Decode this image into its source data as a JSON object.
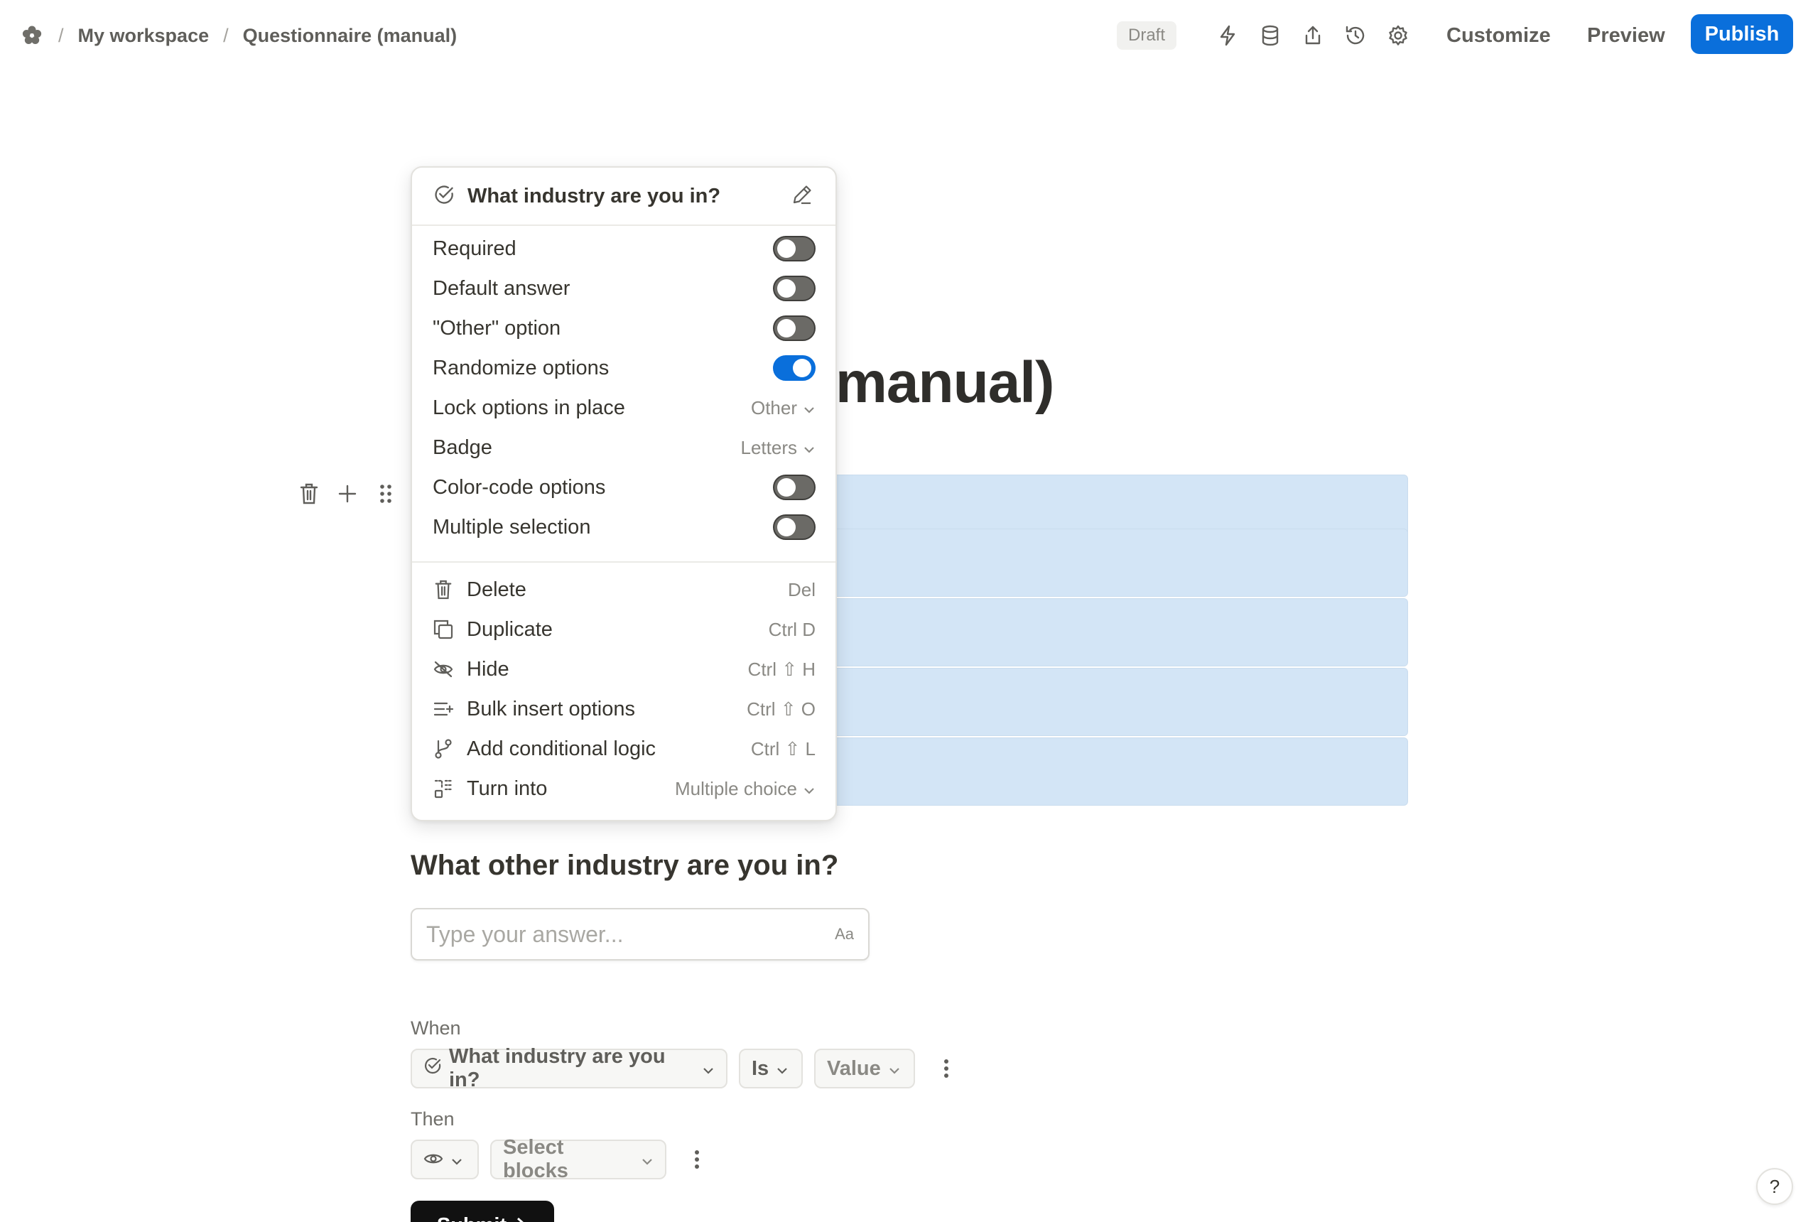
{
  "breadcrumb": {
    "workspace": "My workspace",
    "page": "Questionnaire (manual)",
    "separator": "/"
  },
  "header": {
    "status_badge": "Draft",
    "customize_label": "Customize",
    "preview_label": "Preview",
    "publish_label": "Publish",
    "accent_color": "#0a6fdb"
  },
  "page": {
    "title_fragment": "manual)"
  },
  "menu": {
    "question_title": "What industry are you in?",
    "settings": [
      {
        "label": "Required",
        "type": "toggle",
        "on": false
      },
      {
        "label": "Default answer",
        "type": "toggle",
        "on": false
      },
      {
        "label": "\"Other\" option",
        "type": "toggle",
        "on": false
      },
      {
        "label": "Randomize options",
        "type": "toggle",
        "on": true
      },
      {
        "label": "Lock options in place",
        "type": "select",
        "value": "Other"
      },
      {
        "label": "Badge",
        "type": "select",
        "value": "Letters"
      },
      {
        "label": "Color-code options",
        "type": "toggle",
        "on": false
      },
      {
        "label": "Multiple selection",
        "type": "toggle",
        "on": false
      }
    ],
    "actions": [
      {
        "label": "Delete",
        "icon": "trash-icon",
        "shortcut": "Del"
      },
      {
        "label": "Duplicate",
        "icon": "duplicate-icon",
        "shortcut": "Ctrl D"
      },
      {
        "label": "Hide",
        "icon": "eye-off-icon",
        "shortcut": "Ctrl ⇧ H"
      },
      {
        "label": "Bulk insert options",
        "icon": "bulk-insert-icon",
        "shortcut": "Ctrl ⇧ O"
      },
      {
        "label": "Add conditional logic",
        "icon": "branch-icon",
        "shortcut": "Ctrl ⇧ L"
      },
      {
        "label": "Turn into",
        "icon": "turn-into-icon",
        "value": "Multiple choice"
      }
    ]
  },
  "question2": {
    "title": "What other industry are you in?",
    "placeholder": "Type your answer...",
    "text_badge": "Aa"
  },
  "logic": {
    "when_label": "When",
    "condition_question": "What industry are you in?",
    "operator": "Is",
    "value": "Value",
    "then_label": "Then",
    "select_blocks": "Select blocks"
  },
  "submit_label": "Submit",
  "help_label": "?"
}
